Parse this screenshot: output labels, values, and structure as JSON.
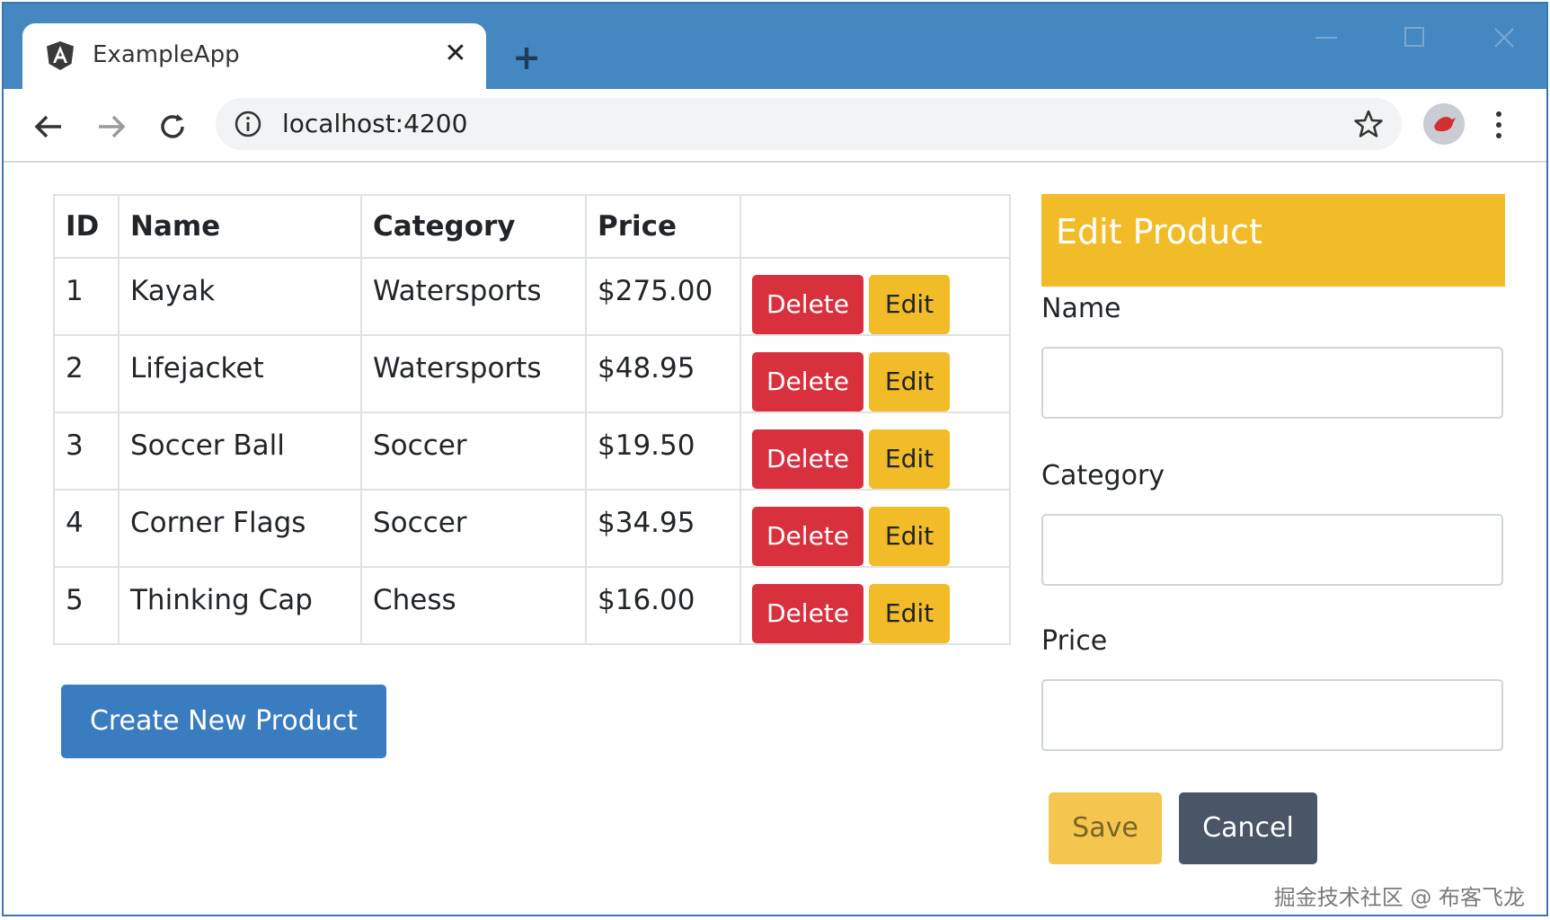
{
  "browser": {
    "tab_title": "ExampleApp",
    "url": "localhost:4200"
  },
  "table": {
    "headers": [
      "ID",
      "Name",
      "Category",
      "Price",
      ""
    ],
    "rows": [
      {
        "id": "1",
        "name": "Kayak",
        "category": "Watersports",
        "price": "$275.00"
      },
      {
        "id": "2",
        "name": "Lifejacket",
        "category": "Watersports",
        "price": "$48.95"
      },
      {
        "id": "3",
        "name": "Soccer Ball",
        "category": "Soccer",
        "price": "$19.50"
      },
      {
        "id": "4",
        "name": "Corner Flags",
        "category": "Soccer",
        "price": "$34.95"
      },
      {
        "id": "5",
        "name": "Thinking Cap",
        "category": "Chess",
        "price": "$16.00"
      }
    ],
    "delete_label": "Delete",
    "edit_label": "Edit"
  },
  "create_button": "Create New Product",
  "edit_panel": {
    "title": "Edit Product",
    "name_label": "Name",
    "name_value": "",
    "category_label": "Category",
    "category_value": "",
    "price_label": "Price",
    "price_value": "",
    "save_label": "Save",
    "cancel_label": "Cancel"
  },
  "watermark": "掘金技术社区 @ 布客飞龙",
  "colors": {
    "tabstrip": "#4587c0",
    "delete": "#d9303e",
    "edit": "#f2bb28",
    "primary": "#3a7cc0",
    "cancel": "#4a5668"
  }
}
